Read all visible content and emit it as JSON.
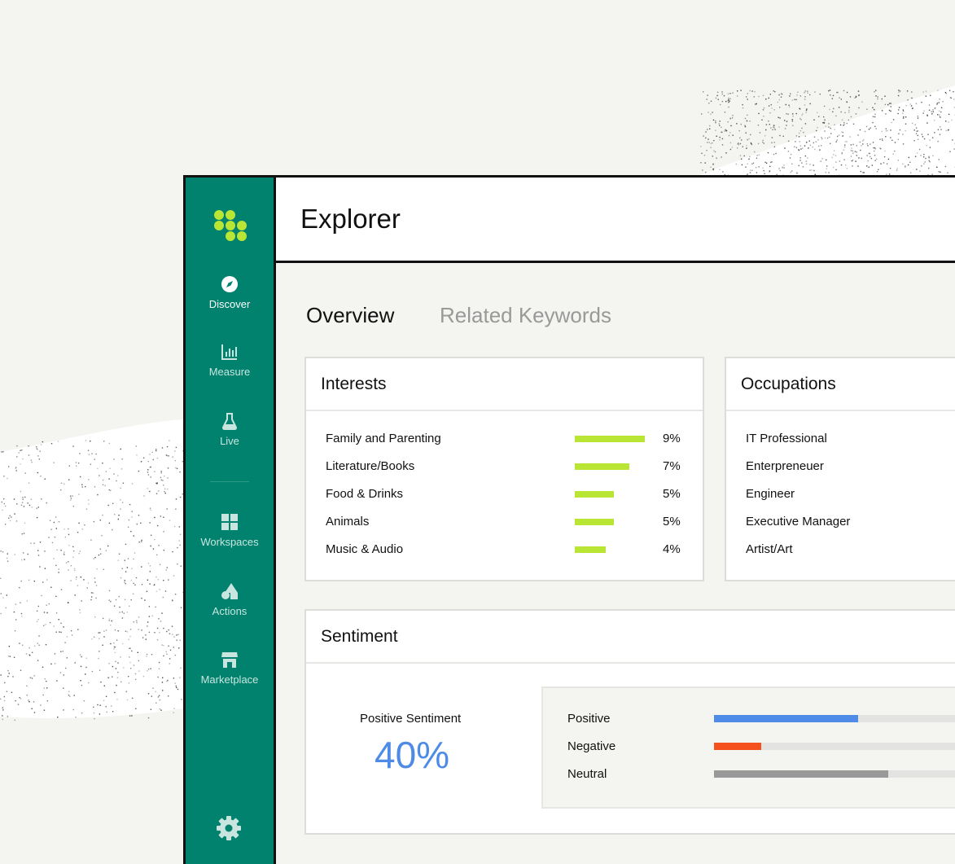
{
  "colors": {
    "sidebar": "#00826f",
    "accent_green": "#b9e534",
    "positive": "#4d8be6",
    "negative": "#f4511e",
    "neutral": "#999999"
  },
  "sidebar": {
    "items": [
      {
        "label": "Discover",
        "icon": "compass-icon",
        "active": true
      },
      {
        "label": "Measure",
        "icon": "bar-chart-icon"
      },
      {
        "label": "Live",
        "icon": "flask-icon"
      },
      {
        "label": "Workspaces",
        "icon": "grid-icon"
      },
      {
        "label": "Actions",
        "icon": "shapes-icon"
      },
      {
        "label": "Marketplace",
        "icon": "store-icon"
      }
    ],
    "settings_icon": "gear-icon"
  },
  "header": {
    "title": "Explorer"
  },
  "tabs": [
    {
      "label": "Overview",
      "active": true
    },
    {
      "label": "Related Keywords",
      "active": false
    }
  ],
  "interests": {
    "title": "Interests",
    "rows": [
      {
        "label": "Family and Parenting",
        "pct": "9%",
        "value": 9
      },
      {
        "label": "Literature/Books",
        "pct": "7%",
        "value": 7
      },
      {
        "label": "Food & Drinks",
        "pct": "5%",
        "value": 5
      },
      {
        "label": "Animals",
        "pct": "5%",
        "value": 5
      },
      {
        "label": "Music & Audio",
        "pct": "4%",
        "value": 4
      }
    ]
  },
  "occupations": {
    "title": "Occupations",
    "rows": [
      {
        "label": "IT Professional"
      },
      {
        "label": "Enterpreneuer"
      },
      {
        "label": "Engineer"
      },
      {
        "label": "Executive Manager"
      },
      {
        "label": "Artist/Art"
      }
    ]
  },
  "sentiment": {
    "title": "Sentiment",
    "summary_label": "Positive Sentiment",
    "summary_value": "40%",
    "rows": [
      {
        "label": "Positive",
        "fraction": 0.52
      },
      {
        "label": "Negative",
        "fraction": 0.17
      },
      {
        "label": "Neutral",
        "fraction": 0.63
      }
    ]
  }
}
